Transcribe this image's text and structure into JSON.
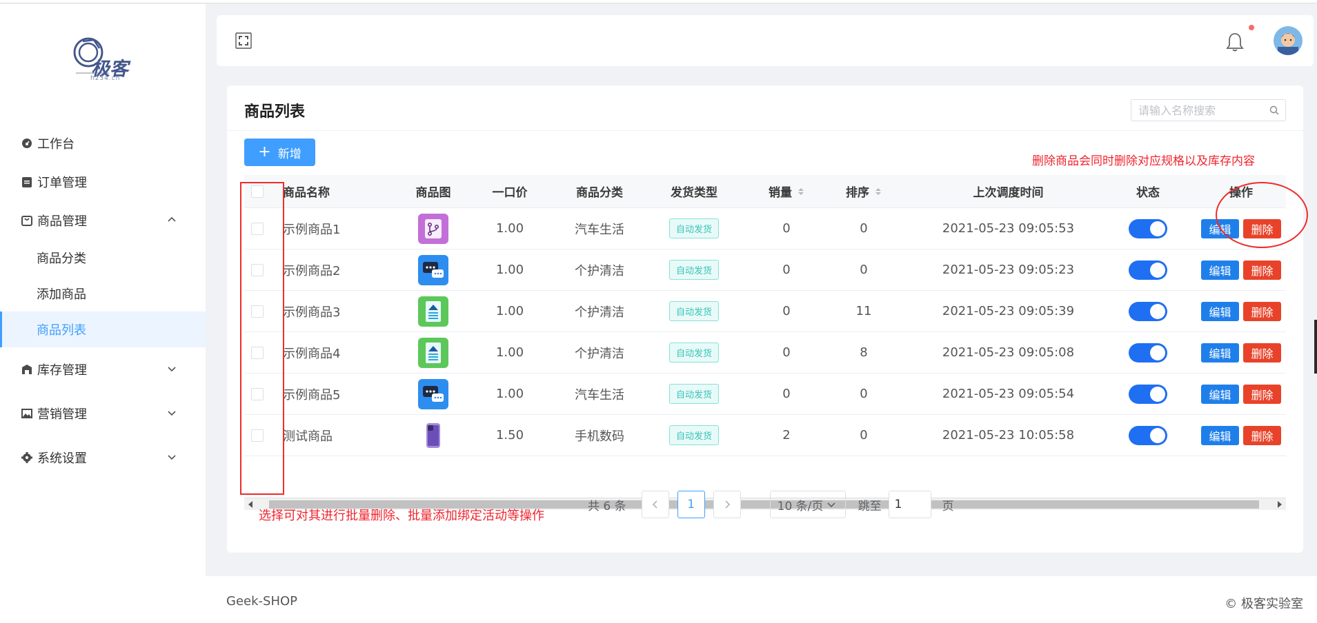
{
  "logo": {
    "text": "极客",
    "sub": "h234.cn"
  },
  "sidebar": {
    "items": [
      {
        "label": "工作台",
        "icon": "dashboard-icon"
      },
      {
        "label": "订单管理",
        "icon": "clipboard-icon"
      },
      {
        "label": "商品管理",
        "icon": "bag-icon",
        "expanded": true,
        "children": [
          "商品分类",
          "添加商品",
          "商品列表"
        ]
      },
      {
        "label": "库存管理",
        "icon": "warehouse-icon"
      },
      {
        "label": "营销管理",
        "icon": "image-icon"
      },
      {
        "label": "系统设置",
        "icon": "gear-icon"
      }
    ],
    "active": "商品列表"
  },
  "main": {
    "title": "商品列表",
    "search_placeholder": "请输入名称搜索",
    "add_label": "新增",
    "note_right": "删除商品会同时删除对应规格以及库存内容",
    "note_left": "选择可对其进行批量删除、批量添加绑定活动等操作"
  },
  "table": {
    "columns": [
      "商品名称",
      "商品图",
      "一口价",
      "商品分类",
      "发货类型",
      "销量",
      "排序",
      "上次调度时间",
      "状态",
      "操作"
    ],
    "rows": [
      {
        "name": "示例商品1",
        "image": "purple-branch-icon",
        "price": "1.00",
        "category": "汽车生活",
        "ship": "自动发货",
        "sales": "0",
        "sort": "0",
        "time": "2021-05-23 09:05:53",
        "status_on": true
      },
      {
        "name": "示例商品2",
        "image": "blue-chat-icon",
        "price": "1.00",
        "category": "个护清洁",
        "ship": "自动发货",
        "sales": "0",
        "sort": "0",
        "time": "2021-05-23 09:05:23",
        "status_on": true
      },
      {
        "name": "示例商品3",
        "image": "green-doc-icon",
        "price": "1.00",
        "category": "个护清洁",
        "ship": "自动发货",
        "sales": "0",
        "sort": "11",
        "time": "2021-05-23 09:05:39",
        "status_on": true
      },
      {
        "name": "示例商品4",
        "image": "green-doc-icon",
        "price": "1.00",
        "category": "个护清洁",
        "ship": "自动发货",
        "sales": "0",
        "sort": "8",
        "time": "2021-05-23 09:05:08",
        "status_on": true
      },
      {
        "name": "示例商品5",
        "image": "blue-chat-icon",
        "price": "1.00",
        "category": "汽车生活",
        "ship": "自动发货",
        "sales": "0",
        "sort": "0",
        "time": "2021-05-23 09:05:54",
        "status_on": true
      },
      {
        "name": "测试商品",
        "image": "phone-icon",
        "price": "1.50",
        "category": "手机数码",
        "ship": "自动发货",
        "sales": "2",
        "sort": "0",
        "time": "2021-05-23 10:05:58",
        "status_on": true
      }
    ],
    "edit_label": "编辑",
    "delete_label": "删除"
  },
  "pagination": {
    "total_text": "共 6 条",
    "current_page": "1",
    "page_size": "10 条/页",
    "jump_label": "跳至",
    "jump_value": "1",
    "page_unit": "页"
  },
  "footer": {
    "left": "Geek-SHOP",
    "right": "© 极客实验室"
  },
  "colors": {
    "primary": "#409eff",
    "danger": "#e8432a",
    "switch_on": "#1f6ff2",
    "annotation": "#ee2b2b"
  }
}
